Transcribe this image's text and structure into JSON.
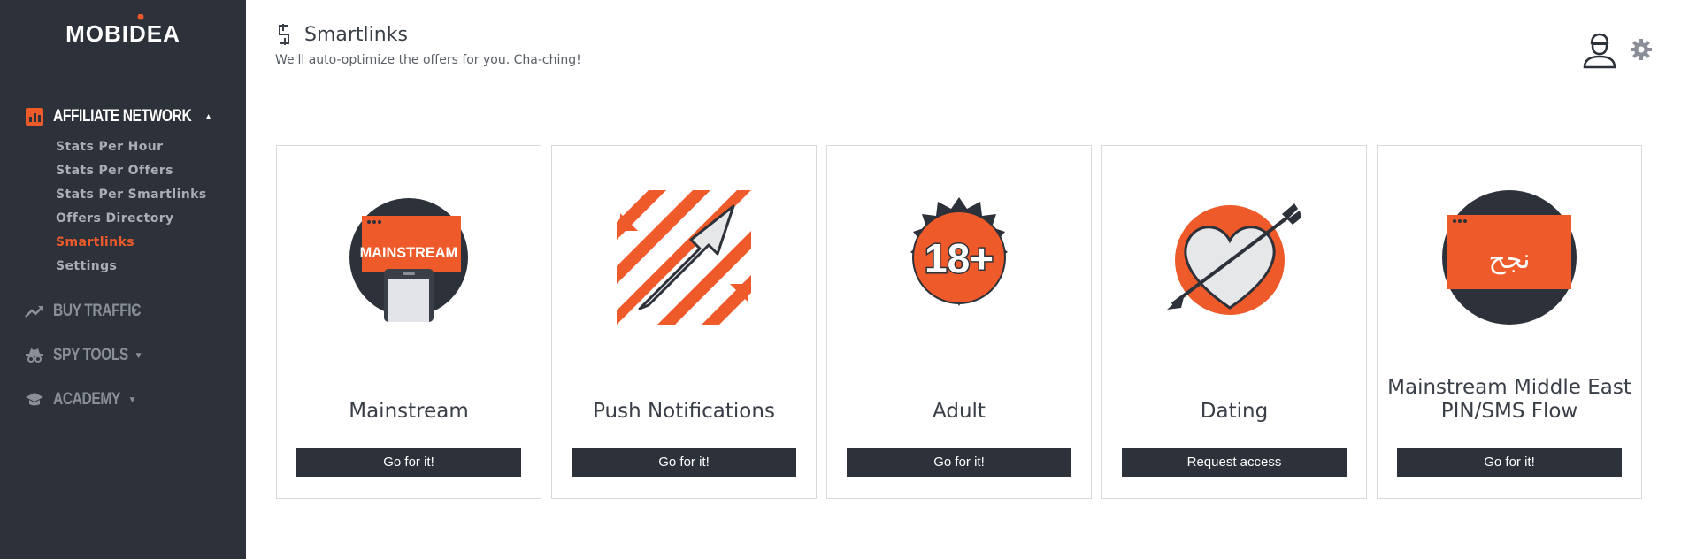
{
  "brand": {
    "logo_text": "MOBIDEA",
    "accent": "#ee5a29",
    "sidebar_bg": "#2c313a"
  },
  "sidebar": {
    "affiliate": {
      "label": "AFFILIATE NETWORK",
      "items": [
        {
          "label": "Stats Per Hour"
        },
        {
          "label": "Stats Per Offers"
        },
        {
          "label": "Stats Per Smartlinks"
        },
        {
          "label": "Offers Directory"
        },
        {
          "label": "Smartlinks"
        },
        {
          "label": "Settings"
        }
      ]
    },
    "buy_traffic": {
      "label": "BUY TRAFFIC"
    },
    "spy_tools": {
      "label": "SPY TOOLS"
    },
    "academy": {
      "label": "ACADEMY"
    }
  },
  "header": {
    "title": "Smartlinks",
    "subtitle": "We'll auto-optimize the offers for you. Cha-ching!"
  },
  "cards": [
    {
      "name": "Mainstream",
      "button": "Go for it!",
      "badge_text": "MAINSTREAM",
      "icon": "mainstream-icon"
    },
    {
      "name": "Push Notifications",
      "button": "Go for it!",
      "icon": "push-arrow-icon"
    },
    {
      "name": "Adult",
      "button": "Go for it!",
      "badge_text": "18+",
      "icon": "adult-badge-icon"
    },
    {
      "name": "Dating",
      "button": "Request access",
      "icon": "heart-arrow-icon"
    },
    {
      "name": "Mainstream Middle East PIN/SMS Flow",
      "button": "Go for it!",
      "badge_text": "نجح",
      "icon": "arabic-window-icon"
    }
  ]
}
